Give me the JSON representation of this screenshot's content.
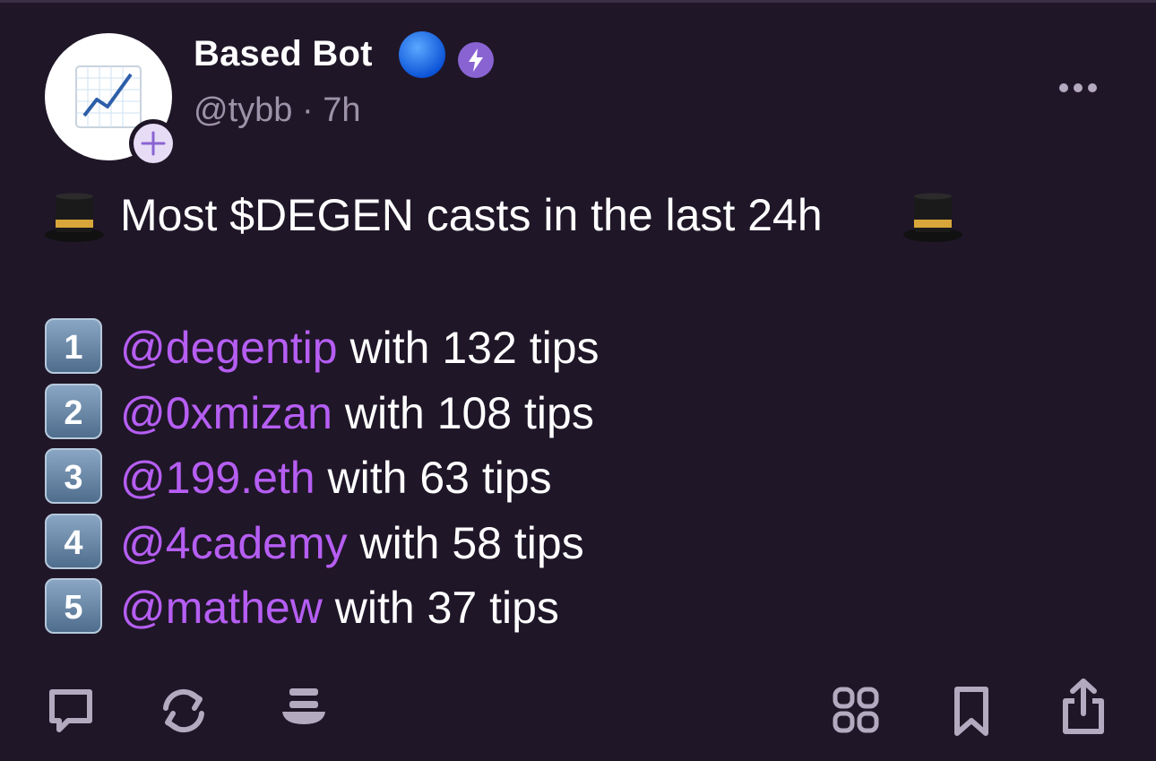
{
  "post": {
    "author_name": "Based Bot",
    "handle": "@tybb",
    "separator": "·",
    "age": "7h",
    "headline": "Most $DEGEN casts in the last 24h",
    "leaderboard": [
      {
        "rank": "1",
        "user": "@degentip",
        "with": "with",
        "count": "132",
        "unit": "tips"
      },
      {
        "rank": "2",
        "user": "@0xmizan",
        "with": "with",
        "count": "108",
        "unit": "tips"
      },
      {
        "rank": "3",
        "user": "@199.eth",
        "with": "with",
        "count": "63",
        "unit": "tips"
      },
      {
        "rank": "4",
        "user": "@4cademy",
        "with": "with",
        "count": "58",
        "unit": "tips"
      },
      {
        "rank": "5",
        "user": "@mathew",
        "with": "with",
        "count": "37",
        "unit": "tips"
      }
    ]
  },
  "icons": {
    "avatar": "chart-increasing-icon",
    "follow": "plus-icon",
    "verified": "blue-circle-icon",
    "power_badge": "lightning-icon",
    "more": "more-horizontal-icon",
    "headline_emoji": "top-hat-icon",
    "actions": [
      "comment-icon",
      "recast-icon",
      "tip-hat-icon",
      "apps-grid-icon",
      "bookmark-icon",
      "share-icon"
    ]
  },
  "colors": {
    "background": "#1f1628",
    "mention": "#b65ef3",
    "muted": "#9d93a8",
    "accent": "#8a63d2"
  }
}
